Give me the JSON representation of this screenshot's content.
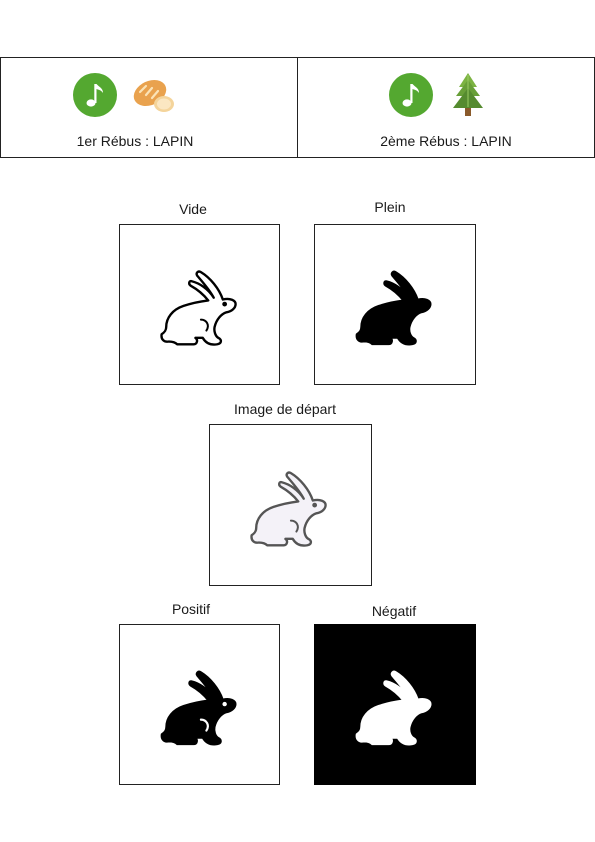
{
  "rebus": [
    {
      "label": "1er Rébus : LAPIN",
      "icons": [
        "music-note-icon",
        "bread-icon"
      ]
    },
    {
      "label": "2ème Rébus : LAPIN",
      "icons": [
        "music-note-icon",
        "pine-tree-icon"
      ]
    }
  ],
  "captions": {
    "empty": "Vide",
    "full": "Plein",
    "original": "Image de départ",
    "positive": "Positif",
    "negative": "Négatif"
  },
  "colors": {
    "note_green": "#54a830",
    "negative_bg": "#000000",
    "outline_gray": "#555555"
  }
}
